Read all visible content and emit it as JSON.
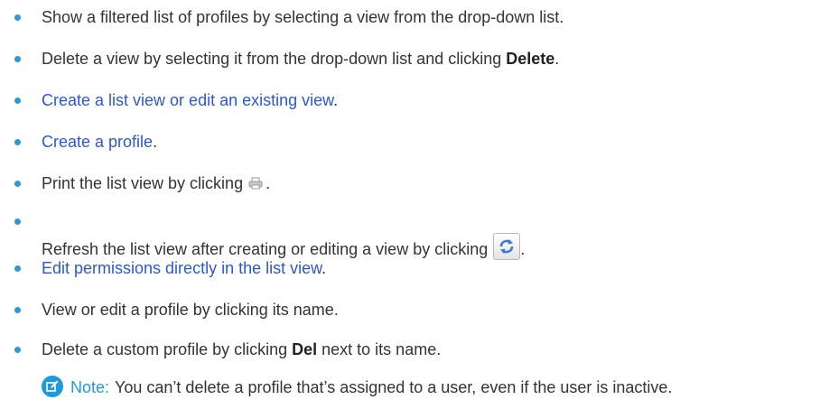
{
  "colors": {
    "bullet": "#2a9bd6",
    "link": "#2b57d9",
    "note": "#1e9ad9"
  },
  "items": [
    {
      "text_before": "Show a filtered list of profiles by selecting a view from the drop-down list.",
      "is_link": false
    },
    {
      "text_before": "Delete a view by selecting it from the drop-down list and clicking ",
      "bold": "Delete",
      "text_after": ".",
      "is_link": false
    },
    {
      "link_text": "Create a list view or edit an existing view",
      "text_after": ".",
      "is_link": true
    },
    {
      "link_text": "Create a profile",
      "text_after": ".",
      "is_link": true
    },
    {
      "text_before": "Print the list view by clicking",
      "icon": "print-icon",
      "text_after": ".",
      "is_link": false
    },
    {
      "text_before": "Refresh the list view after creating or editing a view by clicking",
      "icon": "refresh-icon",
      "text_after": ".",
      "is_link": false
    },
    {
      "link_text": "Edit permissions directly in the list view",
      "text_after": ".",
      "is_link": true
    },
    {
      "text_before": "View or edit a profile by clicking its name.",
      "is_link": false
    },
    {
      "text_before": "Delete a custom profile by clicking ",
      "bold": "Del",
      "text_after": " next to its name.",
      "is_link": false
    }
  ],
  "note": {
    "icon": "note-edit-icon",
    "label": "Note:",
    "text": "You can’t delete a profile that’s assigned to a user, even if the user is inactive."
  }
}
